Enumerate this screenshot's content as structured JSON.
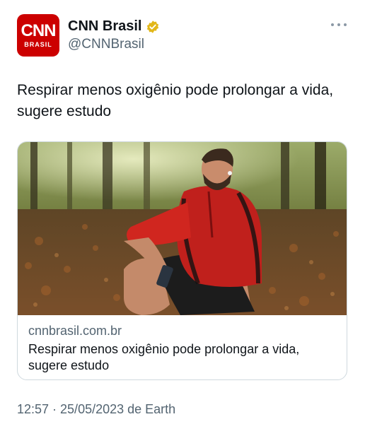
{
  "account": {
    "display_name": "CNN Brasil",
    "handle": "@CNNBrasil",
    "verified": true,
    "avatar_logo": "CNN",
    "avatar_sub": "BRASIL",
    "avatar_color": "#cc0000",
    "verified_color": "#e2b719"
  },
  "tweet": {
    "text": "Respirar menos oxigênio pode prolongar a vida, sugere estudo"
  },
  "card": {
    "image_icon": "man-breathing-in-forest-photo",
    "domain": "cnnbrasil.com.br",
    "title": "Respirar menos oxigênio pode prolongar a vida, sugere estudo"
  },
  "meta": {
    "timestamp": "12:57 · 25/05/2023 de Earth"
  },
  "icons": {
    "more": "more-options-icon",
    "verified": "verified-badge-icon"
  }
}
